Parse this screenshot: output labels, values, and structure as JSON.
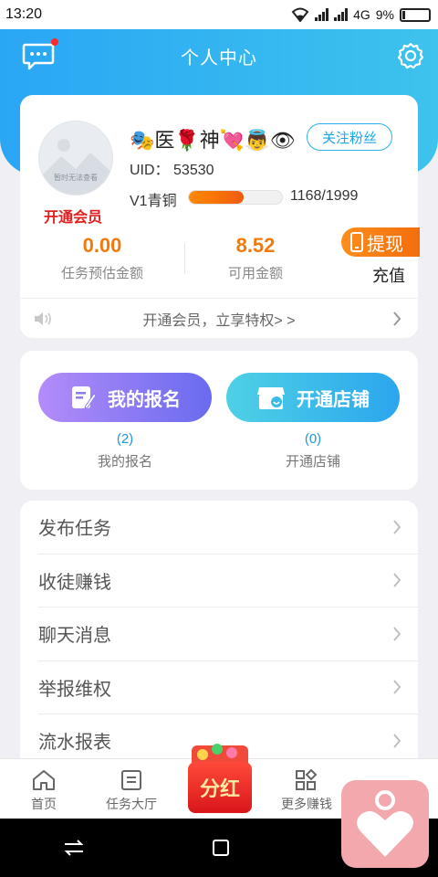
{
  "status_bar": {
    "time": "13:20",
    "network": "4G",
    "battery": "9%"
  },
  "header": {
    "title": "个人中心"
  },
  "profile": {
    "avatar_caption": "暂时无法查看",
    "vip_link": "开通会员",
    "nickname": "🎭医🌹神💘👼👁",
    "follow_label": "关注粉丝",
    "uid_label": "UID：",
    "uid": "53530",
    "level_label": "V1青铜",
    "level_progress": "1168/1999",
    "level_fraction": 0.584
  },
  "stats": {
    "estimated": {
      "value": "0.00",
      "label": "任务预估金额"
    },
    "available": {
      "value": "8.52",
      "label": "可用金额"
    }
  },
  "withdraw_label": "提现",
  "recharge_label": "充值",
  "notice_text": "开通会员，立享特权> >",
  "actions": {
    "signup": {
      "button": "我的报名",
      "count": "(2)",
      "label": "我的报名"
    },
    "shop": {
      "button": "开通店铺",
      "count": "(0)",
      "label": "开通店铺"
    }
  },
  "menu": [
    "发布任务",
    "收徒赚钱",
    "聊天消息",
    "举报维权",
    "流水报表"
  ],
  "tabs": {
    "home": "首页",
    "tasks": "任务大厅",
    "bonus": "分红",
    "more": "更多赚钱"
  },
  "colors": {
    "primary": "#2aa6f5",
    "accent": "#f07b0c",
    "vip": "#e02020"
  }
}
